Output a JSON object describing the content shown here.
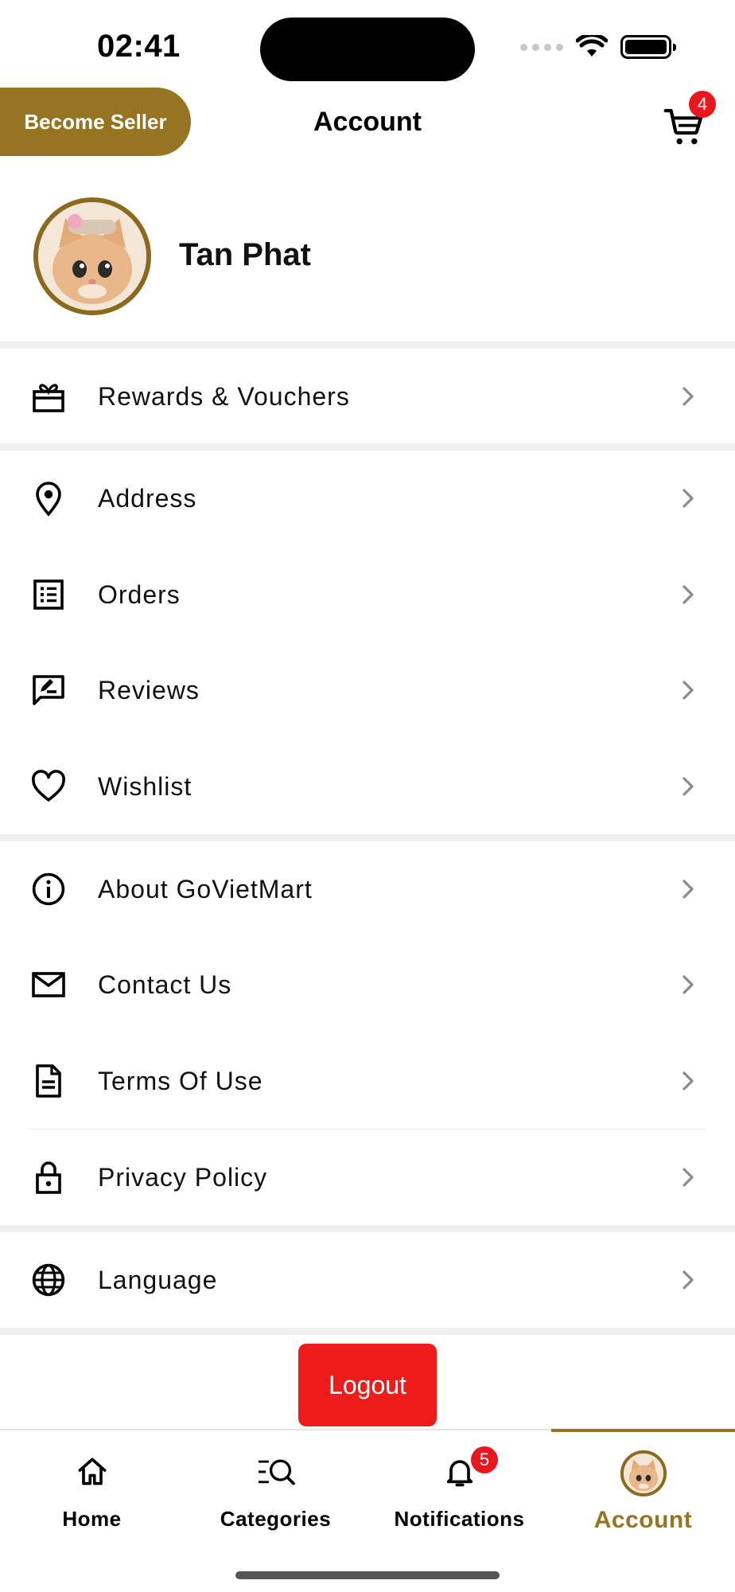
{
  "status_bar": {
    "time": "02:41"
  },
  "header": {
    "seller_button": "Become Seller",
    "title": "Account",
    "cart_count": "4"
  },
  "profile": {
    "name": "Tan Phat"
  },
  "menu": {
    "rewards": "Rewards & Vouchers",
    "address": "Address",
    "orders": "Orders",
    "reviews": "Reviews",
    "wishlist": "Wishlist",
    "about": "About GoVietMart",
    "contact": "Contact Us",
    "terms": "Terms Of Use",
    "privacy": "Privacy Policy",
    "language": "Language"
  },
  "logout_label": "Logout",
  "bottom_nav": {
    "home": "Home",
    "categories": "Categories",
    "notifications": "Notifications",
    "notifications_count": "5",
    "account": "Account",
    "active_tab": "Account"
  },
  "colors": {
    "brand": "#967421",
    "danger": "#ee1b1b",
    "divider": "#efefef"
  },
  "icons": {
    "rewards": "gift-icon",
    "address": "location-pin-icon",
    "orders": "list-icon",
    "reviews": "review-icon",
    "wishlist": "heart-icon",
    "about": "info-icon",
    "contact": "mail-icon",
    "terms": "document-icon",
    "privacy": "lock-icon",
    "language": "globe-icon"
  }
}
